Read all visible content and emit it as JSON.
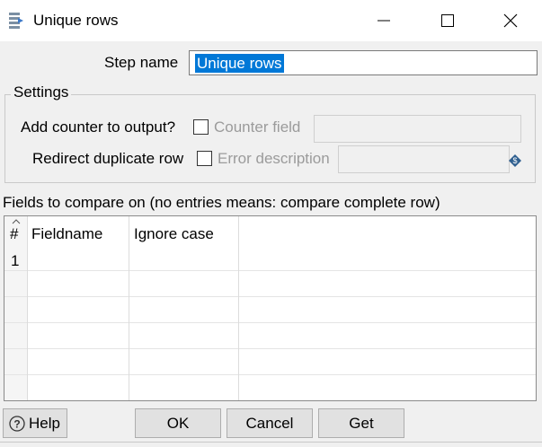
{
  "window": {
    "title": "Unique rows",
    "app_icon": "unique-rows-step-icon"
  },
  "step": {
    "label": "Step name",
    "value": "Unique rows"
  },
  "settings": {
    "title": "Settings",
    "add_counter_label": "Add counter to output?",
    "add_counter_checked": false,
    "counter_field_label": "Counter field",
    "counter_field_value": "",
    "redirect_label": "Redirect duplicate row",
    "redirect_checked": false,
    "error_description_label": "Error description",
    "error_description_value": "",
    "variable_icon": "variable-diamond-icon"
  },
  "fields": {
    "title": "Fields to compare on (no entries means: compare complete row)",
    "columns": [
      "#",
      "Fieldname",
      "Ignore case"
    ],
    "rows": [
      {
        "num": "1",
        "fieldname": "",
        "ignore_case": ""
      }
    ]
  },
  "buttons": {
    "help": "Help",
    "ok": "OK",
    "cancel": "Cancel",
    "get": "Get"
  },
  "colors": {
    "selection": "#0078d7",
    "background": "#f0f0f0",
    "disabled_text": "#9b9b9b"
  }
}
